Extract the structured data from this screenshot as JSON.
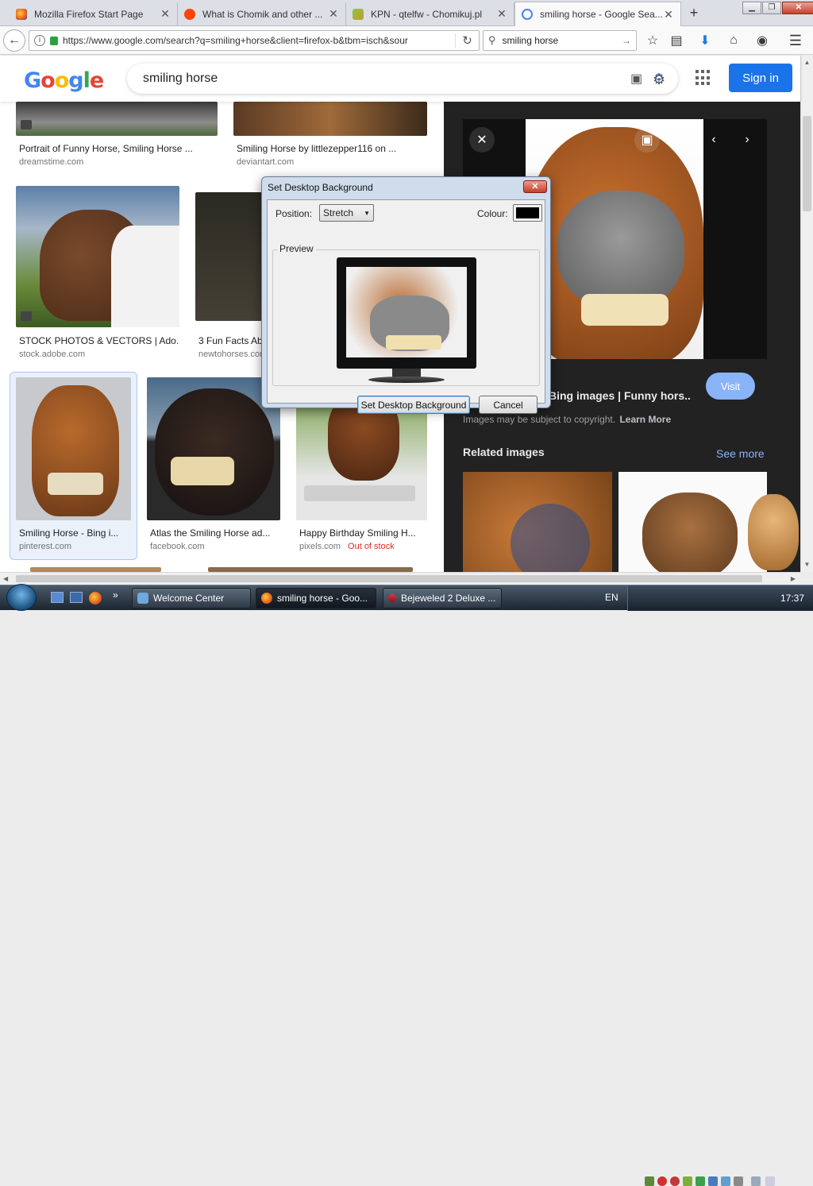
{
  "browser": {
    "window_controls": {
      "minimize": "▁",
      "restore": "❐",
      "close": "✕"
    },
    "tabs": [
      {
        "title": "Mozilla Firefox Start Page",
        "close": "✕",
        "favicon": "firefox-icon"
      },
      {
        "title": "What is Chomik and other ...",
        "close": "✕",
        "favicon": "reddit-icon"
      },
      {
        "title": "KPN - qtelfw - Chomikuj.pl",
        "close": "✕",
        "favicon": "chomikuj-icon"
      },
      {
        "title": "smiling horse - Google Sea...",
        "close": "✕",
        "favicon": "google-icon"
      }
    ],
    "new_tab": "+",
    "url": "https://www.google.com/search?q=smiling+horse&client=firefox-b&tbm=isch&sour",
    "search_value": "smiling horse",
    "accent": "#1a73e8"
  },
  "google": {
    "logo": "Google",
    "query": "smiling horse",
    "signin": "Sign in"
  },
  "results": [
    {
      "caption": "Portrait of Funny Horse, Smiling Horse ...",
      "source": "dreamstime.com"
    },
    {
      "caption": "Smiling Horse by littlezepper116 on ...",
      "source": "deviantart.com"
    },
    {
      "caption": "STOCK PHOTOS & VECTORS | Ado...",
      "source": "stock.adobe.com"
    },
    {
      "caption": "3 Fun Facts Ab",
      "source": "newtohorses.com"
    },
    {
      "caption": "Smiling Horse - Bing i...",
      "source": "pinterest.com"
    },
    {
      "caption": "Atlas the Smiling Horse ad...",
      "source": "facebook.com"
    },
    {
      "caption": "Happy Birthday Smiling H...",
      "source": "pixels.com",
      "status": "Out of stock"
    }
  ],
  "panel": {
    "title": "Bing images | Funny hors...",
    "visit": "Visit",
    "copyright": "Images may be subject to copyright.",
    "learn_more": "Learn More",
    "related": "Related images",
    "see_more": "See more"
  },
  "dialog": {
    "title": "Set Desktop Background",
    "position_label": "Position:",
    "position_value": "Stretch",
    "colour_label": "Colour:",
    "colour_value": "#000000",
    "preview_label": "Preview",
    "set_button": "Set Desktop Background",
    "cancel_button": "Cancel"
  },
  "taskbar": {
    "tasks": [
      {
        "label": "Welcome Center"
      },
      {
        "label": "smiling horse - Goo..."
      },
      {
        "label": "Bejeweled 2 Deluxe ..."
      }
    ],
    "language": "EN",
    "clock": "17:37"
  }
}
